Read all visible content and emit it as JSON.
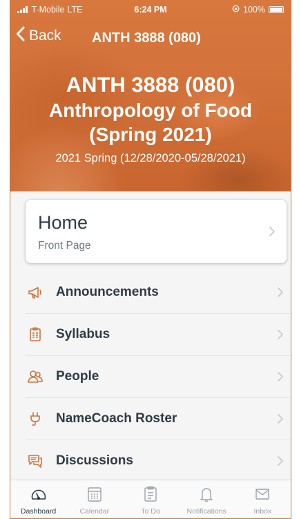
{
  "status_bar": {
    "carrier": "T-Mobile",
    "network": "LTE",
    "time": "6:24 PM",
    "battery": "100%"
  },
  "nav": {
    "back_label": "Back",
    "title": "ANTH 3888 (080)"
  },
  "course": {
    "code": "ANTH 3888 (080)",
    "name_line1": "Anthropology of Food",
    "name_line2": "(Spring 2021)",
    "term": "2021 Spring (12/28/2020-05/28/2021)"
  },
  "home": {
    "title": "Home",
    "subtitle": "Front Page"
  },
  "menu": {
    "items": [
      {
        "label": "Announcements",
        "icon": "megaphone-icon"
      },
      {
        "label": "Syllabus",
        "icon": "clipboard-icon"
      },
      {
        "label": "People",
        "icon": "people-icon"
      },
      {
        "label": "NameCoach Roster",
        "icon": "plug-icon"
      },
      {
        "label": "Discussions",
        "icon": "discussion-icon"
      }
    ]
  },
  "tabbar": {
    "items": [
      {
        "label": "Dashboard",
        "icon": "dashboard-icon",
        "active": true
      },
      {
        "label": "Calendar",
        "icon": "calendar-icon",
        "active": false
      },
      {
        "label": "To Do",
        "icon": "todo-icon",
        "active": false
      },
      {
        "label": "Notifications",
        "icon": "bell-icon",
        "active": false
      },
      {
        "label": "Inbox",
        "icon": "inbox-icon",
        "active": false
      }
    ]
  },
  "colors": {
    "brand_orange": "#d2713a",
    "text_dark": "#2d3b45",
    "text_muted": "#6b7780",
    "tab_inactive": "#9aa3a9"
  }
}
